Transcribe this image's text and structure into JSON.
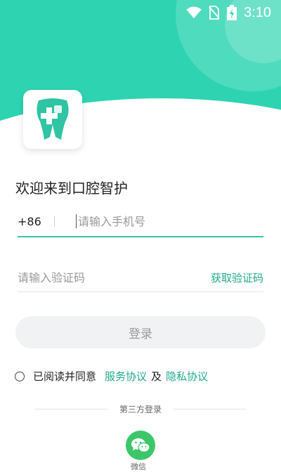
{
  "status_bar": {
    "time": "3:10"
  },
  "app": {
    "welcome": "欢迎来到口腔智护"
  },
  "phone": {
    "country_code": "+86",
    "placeholder": "请输入手机号",
    "value": ""
  },
  "code": {
    "placeholder": "请输入验证码",
    "get_code": "获取验证码"
  },
  "login": {
    "label": "登录"
  },
  "agreement": {
    "prefix": "已阅读并同意",
    "service": "服务协议",
    "and": "及",
    "privacy": "隐私协议"
  },
  "third_party": {
    "title": "第三方登录",
    "wechat": "微信"
  },
  "colors": {
    "accent": "#2ed4b1",
    "link": "#1fa98c",
    "wechat": "#3cc66a"
  },
  "icons": [
    "wifi-icon",
    "no-sim-icon",
    "battery-icon",
    "tooth-logo-icon",
    "radio-unchecked-icon",
    "wechat-icon"
  ]
}
